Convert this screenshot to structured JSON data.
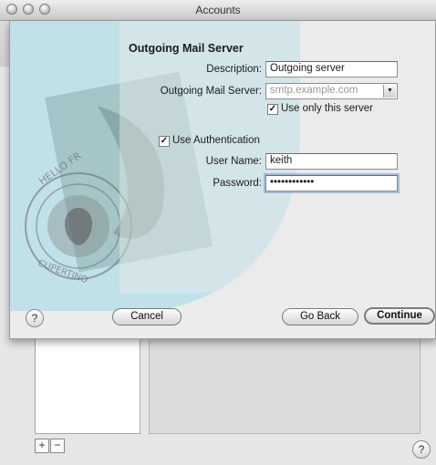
{
  "window": {
    "title": "Accounts"
  },
  "list_controls": {
    "add_label": "+",
    "remove_label": "−"
  },
  "help": {
    "label": "?"
  },
  "sheet": {
    "title": "Outgoing Mail Server",
    "description": {
      "label": "Description:",
      "value": "Outgoing server"
    },
    "server": {
      "label": "Outgoing Mail Server:",
      "placeholder": "smtp.example.com"
    },
    "use_only": {
      "label": "Use only this server",
      "checked": true
    },
    "use_auth": {
      "label": "Use Authentication",
      "checked": true
    },
    "username": {
      "label": "User Name:",
      "value": "keith"
    },
    "password": {
      "label": "Password:",
      "value": "••••••••••••"
    },
    "buttons": {
      "cancel": "Cancel",
      "go_back": "Go Back",
      "continue": "Continue"
    }
  },
  "watermark_stamp_text": "HELLO FROM CUPERTINO",
  "colors": {
    "watermark_blue": "#b8dfe8",
    "stamp_gray": "#6f6f6f"
  }
}
